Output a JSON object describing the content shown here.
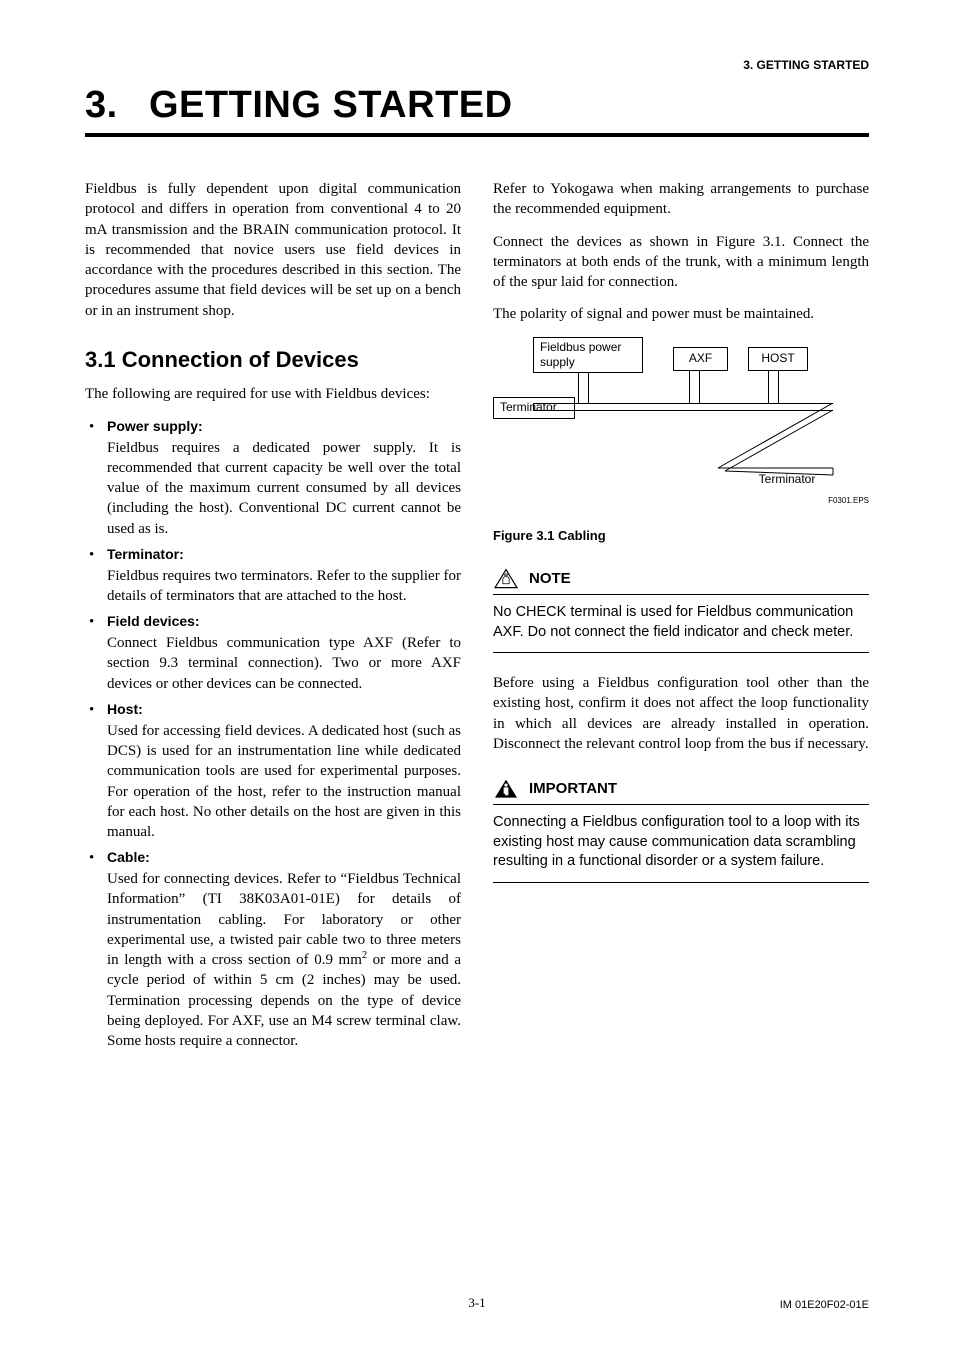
{
  "running_head": "3.  GETTING STARTED",
  "chapter": {
    "num": "3.",
    "title": "GETTING STARTED"
  },
  "left": {
    "intro": "Fieldbus is fully dependent upon digital communication protocol and differs in operation from conventional 4 to 20 mA transmission and the BRAIN communication protocol. It is recommended that novice users use field devices in accordance with the procedures described in this section. The procedures assume that field devices will be set up on a bench or in an instrument shop.",
    "section_title": "3.1  Connection of Devices",
    "section_lead": "The following are required for use with Fieldbus devices:",
    "items": [
      {
        "title": "Power supply:",
        "body": "Fieldbus requires a dedicated power supply. It is recommended that current capacity be well over the total value of the maximum current consumed by all devices (including the host). Conventional DC current cannot be used as is."
      },
      {
        "title": "Terminator:",
        "body": "Fieldbus requires two terminators. Refer to the supplier for details of terminators that are attached to the host."
      },
      {
        "title": "Field devices:",
        "body": "Connect Fieldbus communication type AXF (Refer to section 9.3 terminal connection). Two or more AXF devices or other devices can be connected."
      },
      {
        "title": "Host:",
        "body": "Used for accessing field devices. A dedicated host (such as DCS) is used for an instrumentation line while dedicated communication tools are used for experimental purposes. For operation of the host, refer to the instruction manual for each host. No other details on the host are given in this manual."
      },
      {
        "title": "Cable:",
        "body_html": "Used for connecting devices. Refer to “Fieldbus Technical Information” (TI 38K03A01-01E) for details of instrumentation cabling. For laboratory or other experimental use, a twisted pair cable two to three meters in length with a cross section of 0.9 mm<sup>2</sup> or more and a cycle period of within 5 cm (2 inches) may be used. Termination processing depends on the type of device being deployed. For AXF, use an M4 screw terminal claw. Some hosts require a connector."
      }
    ]
  },
  "right": {
    "para1": "Refer to Yokogawa when making arrangements to purchase the recommended equipment.",
    "para2": "Connect the devices as shown in Figure 3.1. Connect the terminators at both ends of the trunk, with a minimum length of the spur laid for connection.",
    "para3": "The polarity of signal and power must be maintained.",
    "diagram": {
      "power": "Fieldbus power supply",
      "axf": "AXF",
      "host": "HOST",
      "terminator": "Terminator",
      "terminator2": "Terminator",
      "eps": "F0301.EPS"
    },
    "fig_caption": "Figure 3.1 Cabling",
    "note": {
      "label": "NOTE",
      "body": "No CHECK terminal is used for Fieldbus communication AXF. Do not connect the field indicator and check meter."
    },
    "mid_para": "Before using a Fieldbus configuration tool other than the existing host, confirm it does not affect the loop functionality in which all devices are already installed in operation. Disconnect the relevant control loop from the bus if necessary.",
    "important": {
      "label": "IMPORTANT",
      "body": "Connecting a Fieldbus configuration tool to a loop with its existing host may cause communication data scrambling resulting in a functional disorder or a system failure."
    }
  },
  "footer": {
    "page": "3-1",
    "doc": "IM 01E20F02-01E"
  }
}
